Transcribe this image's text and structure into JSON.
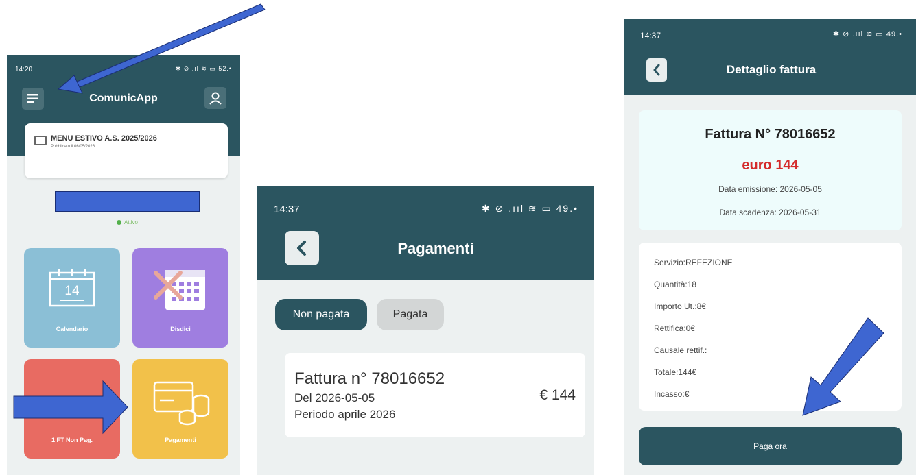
{
  "screen1": {
    "status_time": "14:20",
    "status_icons": "✱ ⊘ .ıl ≋ ▭ 52.•",
    "app_title": "ComunicApp",
    "news_title": "MENU ESTIVO A.S. 2025/2026",
    "news_subtitle": "Pubblicato il 06/05/2026",
    "status_label": "Attivo",
    "calendar_day": "14",
    "tiles": {
      "calendario": "Calendario",
      "disdici": "Disdici",
      "non_pagate": "1 FT Non Pag.",
      "pagamenti": "Pagamenti"
    },
    "colors": {
      "header": "#2b5560",
      "calendario": "#8bbfd6",
      "disdici": "#9f7ee0",
      "non_pagate": "#e86b62",
      "pagamenti": "#f2c14a",
      "redaction": "#3e66d1"
    }
  },
  "screen2": {
    "status_time": "14:37",
    "status_icons": "✱ ⊘ .ııl ≋ ▭ 49.•",
    "title": "Pagamenti",
    "filter_unpaid": "Non pagata",
    "filter_paid": "Pagata",
    "invoice": {
      "title": "Fattura n° 78016652",
      "date": "Del 2026-05-05",
      "period": "Periodo aprile 2026",
      "amount": "€ 144"
    }
  },
  "screen3": {
    "status_time": "14:37",
    "status_icons": "✱ ⊘ .ııl ≋ ▭ 49.•",
    "title": "Dettaglio fattura",
    "invoice_title": "Fattura N° 78016652",
    "amount": "euro 144",
    "issue_date": "Data emissione: 2026-05-05",
    "due_date": "Data scadenza: 2026-05-31",
    "details": {
      "servizio": "Servizio:REFEZIONE",
      "quantita": "Quantità:18",
      "importo": "Importo Ut.:8€",
      "rettifica": "Rettifica:0€",
      "causale": "Causale rettif.:",
      "totale": "Totale:144€",
      "incasso": "Incasso:€"
    },
    "pay_button": "Paga ora",
    "colors": {
      "amount": "#d42b2b",
      "card": "#eefcfc"
    }
  },
  "annotations": {
    "arrow_color": "#3e66d1"
  }
}
